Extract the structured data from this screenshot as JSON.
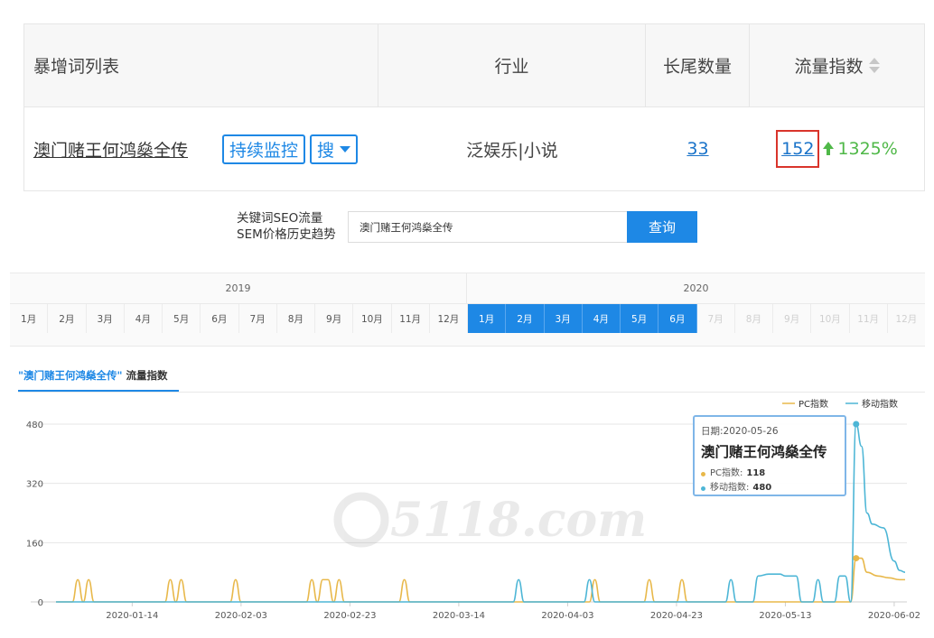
{
  "table": {
    "headers": {
      "keyword_list": "暴增词列表",
      "industry": "行业",
      "long_tail_count": "长尾数量",
      "traffic_index": "流量指数"
    },
    "row": {
      "keyword": "澳门赌王何鸿燊全传",
      "monitor_button": "持续监控",
      "search_button": "搜",
      "industry": "泛娱乐|小说",
      "long_tail_count": "33",
      "traffic_index": "152",
      "growth": "1325%"
    }
  },
  "query": {
    "label_line1": "关键词SEO流量",
    "label_line2": "SEM价格历史趋势",
    "input_value": "澳门赌王何鸿燊全传",
    "button": "查询"
  },
  "months": {
    "years": [
      "2019",
      "2020"
    ],
    "labels_2019": [
      "1月",
      "2月",
      "3月",
      "4月",
      "5月",
      "6月",
      "7月",
      "8月",
      "9月",
      "10月",
      "11月",
      "12月"
    ],
    "labels_2020": [
      "1月",
      "2月",
      "3月",
      "4月",
      "5月",
      "6月",
      "7月",
      "8月",
      "9月",
      "10月",
      "11月",
      "12月"
    ],
    "selected_2020": [
      1,
      2,
      3,
      4,
      5,
      6
    ]
  },
  "chart": {
    "tab_keyword": "\"澳门赌王何鸿燊全传\"",
    "tab_metric": "流量指数",
    "legend": [
      "PC指数",
      "移动指数"
    ],
    "watermark": "5118.com",
    "tooltip": {
      "date": "日期:2020-05-26",
      "title": "澳门赌王何鸿燊全传",
      "pc_label": "PC指数:",
      "pc_value": "118",
      "mobile_label": "移动指数:",
      "mobile_value": "480"
    }
  },
  "colors": {
    "accent": "#1e88e5",
    "pc": "#e8b84a",
    "mobile": "#4db6d6",
    "growth": "#4fb848",
    "highlight": "#d9342b"
  },
  "chart_data": {
    "type": "line",
    "x_tick_labels": [
      "2020-01-14",
      "2020-02-03",
      "2020-02-23",
      "2020-03-14",
      "2020-04-03",
      "2020-04-23",
      "2020-05-13",
      "2020-06-02"
    ],
    "y_tick_labels": [
      "0",
      "160",
      "320",
      "480"
    ],
    "ylim": [
      0,
      480
    ],
    "x_range": [
      "2019-12-31",
      "2020-06-04"
    ],
    "grid": "horizontal",
    "legend_position": "top-right",
    "series": [
      {
        "name": "PC指数",
        "color": "#e8b84a",
        "points": [
          [
            "2019-12-31",
            0
          ],
          [
            "2020-01-03",
            0
          ],
          [
            "2020-01-04",
            60
          ],
          [
            "2020-01-05",
            0
          ],
          [
            "2020-01-06",
            60
          ],
          [
            "2020-01-07",
            0
          ],
          [
            "2020-01-20",
            0
          ],
          [
            "2020-01-21",
            60
          ],
          [
            "2020-01-22",
            0
          ],
          [
            "2020-01-23",
            60
          ],
          [
            "2020-01-24",
            0
          ],
          [
            "2020-02-01",
            0
          ],
          [
            "2020-02-02",
            60
          ],
          [
            "2020-02-03",
            0
          ],
          [
            "2020-02-15",
            0
          ],
          [
            "2020-02-16",
            60
          ],
          [
            "2020-02-17",
            0
          ],
          [
            "2020-02-18",
            60
          ],
          [
            "2020-02-19",
            60
          ],
          [
            "2020-02-20",
            0
          ],
          [
            "2020-02-21",
            60
          ],
          [
            "2020-02-22",
            0
          ],
          [
            "2020-03-03",
            0
          ],
          [
            "2020-03-04",
            60
          ],
          [
            "2020-03-05",
            0
          ],
          [
            "2020-04-07",
            0
          ],
          [
            "2020-04-08",
            60
          ],
          [
            "2020-04-09",
            0
          ],
          [
            "2020-04-17",
            0
          ],
          [
            "2020-04-18",
            60
          ],
          [
            "2020-04-19",
            0
          ],
          [
            "2020-04-23",
            0
          ],
          [
            "2020-04-24",
            60
          ],
          [
            "2020-04-25",
            0
          ],
          [
            "2020-05-25",
            0
          ],
          [
            "2020-05-26",
            118
          ],
          [
            "2020-05-27",
            118
          ],
          [
            "2020-05-28",
            80
          ],
          [
            "2020-05-30",
            70
          ],
          [
            "2020-06-01",
            65
          ],
          [
            "2020-06-03",
            60
          ],
          [
            "2020-06-04",
            60
          ]
        ]
      },
      {
        "name": "移动指数",
        "color": "#4db6d6",
        "points": [
          [
            "2019-12-31",
            0
          ],
          [
            "2020-03-24",
            0
          ],
          [
            "2020-03-25",
            60
          ],
          [
            "2020-03-26",
            0
          ],
          [
            "2020-04-06",
            0
          ],
          [
            "2020-04-07",
            60
          ],
          [
            "2020-04-08",
            0
          ],
          [
            "2020-05-02",
            0
          ],
          [
            "2020-05-03",
            60
          ],
          [
            "2020-05-04",
            0
          ],
          [
            "2020-05-07",
            0
          ],
          [
            "2020-05-08",
            70
          ],
          [
            "2020-05-10",
            75
          ],
          [
            "2020-05-12",
            75
          ],
          [
            "2020-05-13",
            70
          ],
          [
            "2020-05-15",
            70
          ],
          [
            "2020-05-16",
            0
          ],
          [
            "2020-05-18",
            0
          ],
          [
            "2020-05-19",
            60
          ],
          [
            "2020-05-20",
            0
          ],
          [
            "2020-05-22",
            0
          ],
          [
            "2020-05-23",
            70
          ],
          [
            "2020-05-24",
            70
          ],
          [
            "2020-05-25",
            0
          ],
          [
            "2020-05-26",
            480
          ],
          [
            "2020-05-27",
            420
          ],
          [
            "2020-05-28",
            240
          ],
          [
            "2020-05-29",
            210
          ],
          [
            "2020-05-31",
            200
          ],
          [
            "2020-06-02",
            110
          ],
          [
            "2020-06-03",
            85
          ],
          [
            "2020-06-04",
            80
          ]
        ]
      }
    ],
    "tooltip_date": "2020-05-26"
  }
}
